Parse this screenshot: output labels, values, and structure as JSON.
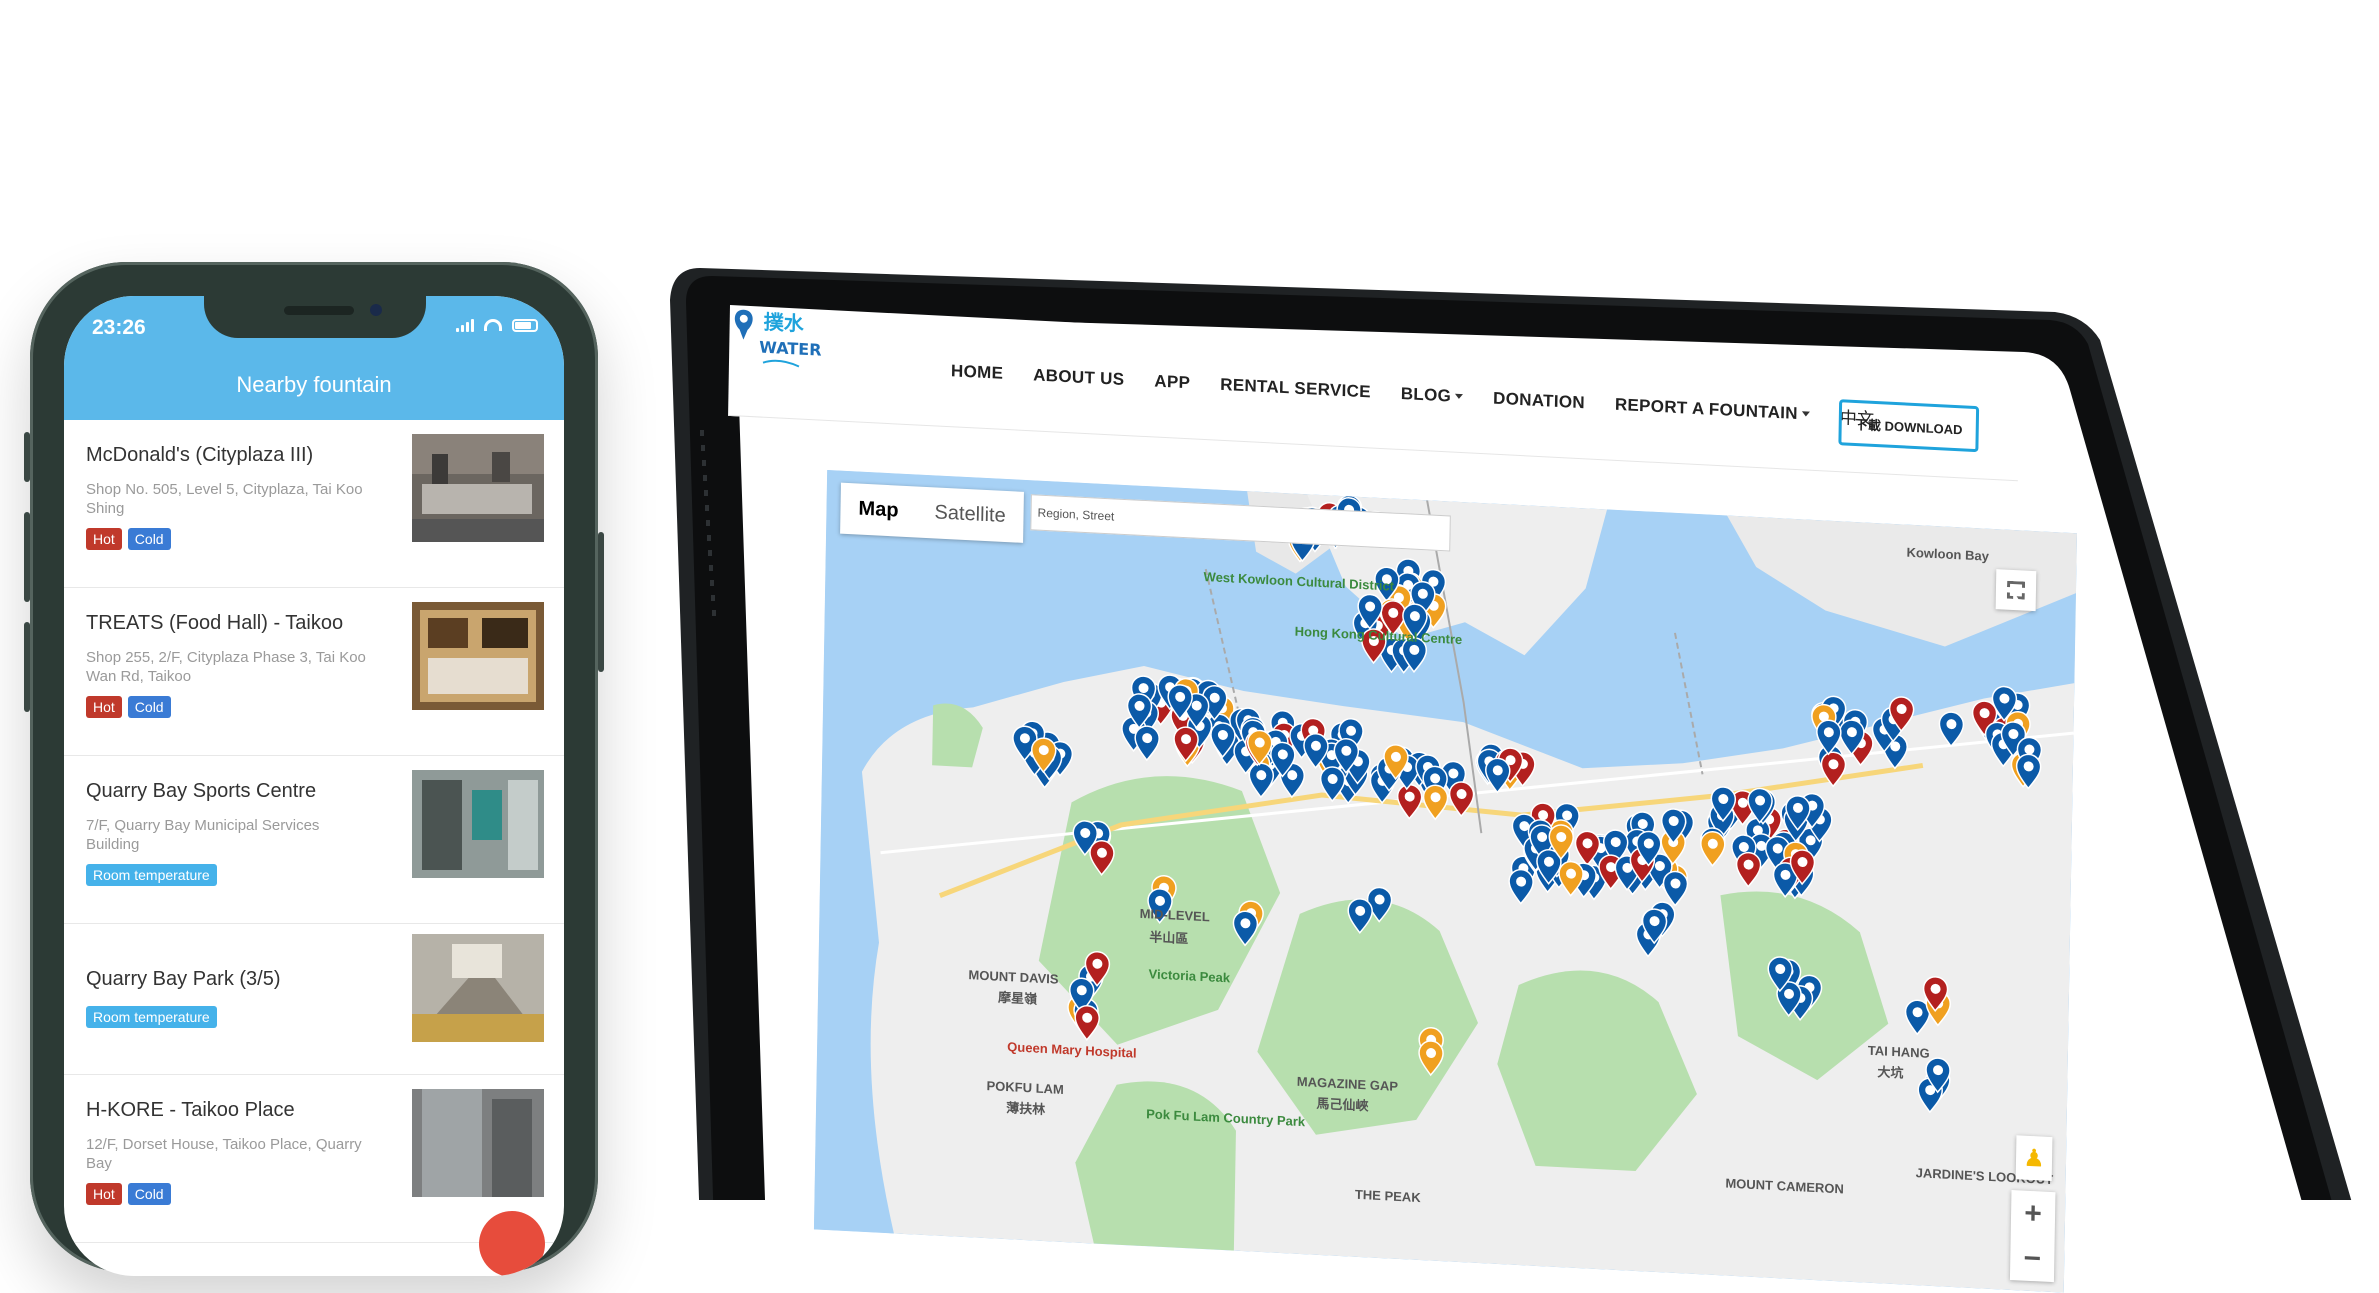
{
  "phone": {
    "status_time": "23:26",
    "title": "Nearby fountain",
    "items": [
      {
        "name": "McDonald's (Cityplaza III)",
        "address": "Shop No. 505, Level 5, Cityplaza, Tai Koo Shing",
        "tags": [
          "Hot",
          "Cold"
        ]
      },
      {
        "name": "TREATS (Food Hall) - Taikoo",
        "address": "Shop 255, 2/F, Cityplaza Phase 3, Tai Koo Wan Rd, Taikoo",
        "tags": [
          "Hot",
          "Cold"
        ]
      },
      {
        "name": "Quarry Bay Sports Centre",
        "address": "7/F, Quarry Bay Municipal Services Building",
        "tags": [
          "Room temperature"
        ]
      },
      {
        "name": "Quarry Bay Park (3/5)",
        "address": "",
        "tags": [
          "Room temperature"
        ]
      },
      {
        "name": "H-KORE - Taikoo Place",
        "address": "12/F, Dorset House, Taikoo Place, Quarry Bay",
        "tags": [
          "Hot",
          "Cold"
        ]
      }
    ]
  },
  "site": {
    "logo_text": "WATER",
    "nav": [
      "HOME",
      "ABOUT US",
      "APP",
      "RENTAL SERVICE",
      "BLOG",
      "DONATION",
      "REPORT A FOUNTAIN",
      "中文"
    ],
    "download_label": "下載 DOWNLOAD"
  },
  "map": {
    "tab_map": "Map",
    "tab_satellite": "Satellite",
    "search_placeholder": "Region, Street",
    "labels": [
      "West Kowloon Cultural District",
      "Hong Kong Cultural Centre",
      "MOUNT DAVIS",
      "摩星嶺",
      "MID-LEVEL",
      "半山區",
      "Victoria Peak",
      "Queen Mary Hospital",
      "POKFU LAM",
      "薄扶林",
      "Pok Fu Lam Country Park",
      "MAGAZINE GAP",
      "馬己仙峽",
      "TAI HANG",
      "大坑",
      "JARDINE'S LOOKOUT",
      "MOUNT CAMERON",
      "THE PEAK",
      "Kowloon Bay"
    ],
    "zoom_in": "+",
    "zoom_out": "−"
  },
  "colors": {
    "header_blue": "#5bb8ea",
    "hot": "#c0392b",
    "cold": "#3a7bd5",
    "room": "#45b2ea",
    "pin_blue": "#0b5aa8",
    "pin_red": "#b3201f",
    "pin_orange": "#f0a020"
  }
}
